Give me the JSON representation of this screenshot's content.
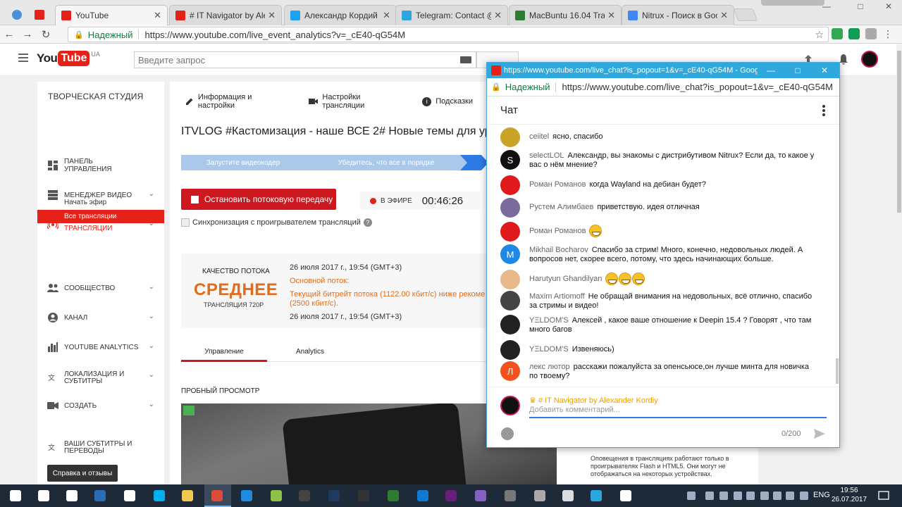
{
  "browser": {
    "tabs": [
      {
        "title": "YouTube",
        "active": true,
        "color": "#e62117"
      },
      {
        "title": "# IT Navigator by Alexan",
        "active": false,
        "color": "#e62117"
      },
      {
        "title": "Александр Кордий (@s",
        "active": false,
        "color": "#1da1f2"
      },
      {
        "title": "Telegram: Contact @it_n",
        "active": false,
        "color": "#2ca5e0"
      },
      {
        "title": "MacBuntu 16.04 Transfo",
        "active": false,
        "color": "#2e7d32"
      },
      {
        "title": "Nitrux - Поиск в Google",
        "active": false,
        "color": "#4285f4"
      }
    ],
    "secure_label": "Надежный",
    "url": "https://www.youtube.com/live_event_analytics?v=_cE40-qG54M"
  },
  "yt": {
    "logo_you": "You",
    "logo_tube": "Tube",
    "logo_region": "UA",
    "search_placeholder": "Введите запрос"
  },
  "sidebar": {
    "title": "ТВОРЧЕСКАЯ СТУДИЯ",
    "items": [
      {
        "label": "Панель управления",
        "icon": "dashboard-icon",
        "chevron": false
      },
      {
        "label": "Менеджер видео",
        "icon": "video-manager-icon",
        "chevron": true
      },
      {
        "label": "Прямые трансляции",
        "icon": "live-icon",
        "chevron": true
      },
      {
        "label": "Сообщество",
        "icon": "community-icon",
        "chevron": true
      },
      {
        "label": "Канал",
        "icon": "channel-icon",
        "chevron": true
      },
      {
        "label": "YouTube Analytics",
        "icon": "analytics-icon",
        "chevron": true
      },
      {
        "label": "Локализация и субтитры",
        "icon": "translate-icon",
        "chevron": true
      },
      {
        "label": "Создать",
        "icon": "create-icon",
        "chevron": true
      },
      {
        "label": "Ваши субтитры и переводы",
        "icon": "subtitles-icon",
        "chevron": false
      }
    ],
    "live_sub": [
      "Начать эфир",
      "Все трансляции"
    ],
    "help_button": "Справка и отзывы"
  },
  "main": {
    "tabs": [
      "Информация и настройки",
      "Настройки трансляции",
      "Подсказки"
    ],
    "title": "ITVLOG #Кастомизация - наше ВСЕ 2# Новые темы для ур",
    "steps": [
      "Запустите видеокодер",
      "Убедитесь, что все в порядке"
    ],
    "stop_button": "Остановить потоковую передачу",
    "onair_label": "В ЭФИРЕ",
    "onair_time": "00:46:26",
    "sync_label": "Синхронизация с проигрывателем трансляций",
    "quality": {
      "caption": "КАЧЕСТВО ПОТОКА",
      "value": "СРЕДНЕЕ",
      "sub": "ТРАНСЛЯЦИЯ 720P",
      "date1": "26 июля 2017 г., 19:54 (GMT+3)",
      "stream_label": "Основной поток:",
      "warn1": "Текущий битрейт потока (1122.00 кбит/с) ниже рекоме",
      "warn2": "(2500 кбит/с).",
      "date2": "26 июля 2017 г., 19:54 (GMT+3)"
    },
    "manage_tabs": [
      "Управление",
      "Analytics"
    ],
    "preview_caption": "ПРОБНЫЙ ПРОСМОТР",
    "notice": "Оповещения в трансляциях работают только в проигрывателях Flash и HTML5. Они могут не отображаться на некоторых устройствах."
  },
  "chat": {
    "window_title": "https://www.youtube.com/live_chat?is_popout=1&v=_cE40-qG54M - Google Ch...",
    "secure_label": "Надежный",
    "url": "https://www.youtube.com/live_chat?is_popout=1&v=_cE40-qG54M",
    "heading": "Чат",
    "messages": [
      {
        "author": "ceiitel",
        "text": "ясно, спасибо",
        "avatar": "",
        "color": "#c9a227"
      },
      {
        "author": "selectLOL",
        "text": "Александр, вы знакомы с дистрибутивом Nitrux? Если да, то какое у вас о нём мнение?",
        "avatar": "S",
        "color": "#111111"
      },
      {
        "author": "Роман Романов",
        "text": "когда Wayland на дебиан будет?",
        "avatar": "",
        "color": "#e0191c"
      },
      {
        "author": "Рустем Алимбаев",
        "text": "приветствую. идея отличная",
        "avatar": "",
        "color": "#7b6a9c"
      },
      {
        "author": "Роман Романов",
        "text": "",
        "avatar": "",
        "color": "#e0191c",
        "emoji": 1
      },
      {
        "author": "Mikhail Bocharov",
        "text": "Спасибо за стрим! Много, конечно, недовольных людей. А вопросов нет, скорее всего, потому, что здесь начинающих больше.",
        "avatar": "M",
        "color": "#1e88e5"
      },
      {
        "author": "Harutyun Ghandilyan",
        "text": "",
        "avatar": "",
        "color": "#e8b88a",
        "emoji": 3
      },
      {
        "author": "Maxim Artiomoff",
        "text": "Не обращай внимания на недовольных, всё отлично, спасибо за стримы и видео!",
        "avatar": "",
        "color": "#444444"
      },
      {
        "author": "YΞLDOM'S",
        "text": "Алексей , какое ваше отношение к Deepin 15.4 ? Говорят , что там много багов",
        "avatar": "",
        "color": "#222222"
      },
      {
        "author": "YΞLDOM'S",
        "text": "Извеняюсь)",
        "avatar": "",
        "color": "#222222"
      },
      {
        "author": "лекс лютор",
        "text": "расскажи пожалуйста за опенсьюсе,он лучше минта для новичка по твоему?",
        "avatar": "Л",
        "color": "#f4511e"
      }
    ],
    "composer_name": "# IT Navigator by Alexander Kordiy",
    "composer_placeholder": "Добавить комментарий...",
    "counter": "0/200"
  },
  "taskbar": {
    "lang": "ENG",
    "time": "19:56",
    "date": "26.07.2017"
  }
}
